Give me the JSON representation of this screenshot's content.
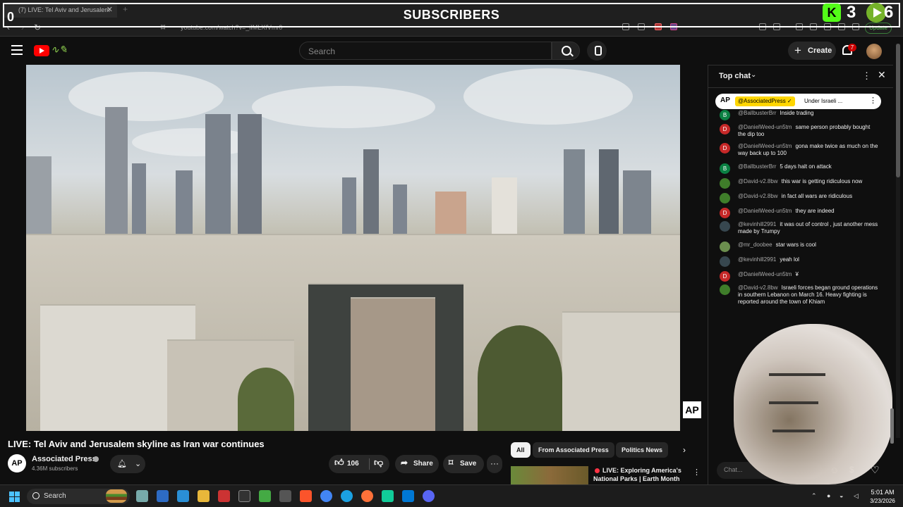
{
  "browser": {
    "tab_title": "(7) LIVE: Tel Aviv and Jerusalem",
    "tab_close": "✕",
    "tab_new": "+",
    "url": "youtube.com/watch?v=_iIMLXfVmr0",
    "update_label": "Update"
  },
  "stream_overlay": {
    "subscriber_counter": "0",
    "subscribers_title": "SUBSCRIBERS",
    "kick_letter": "K",
    "kick_count": "3",
    "rumble_count": "6"
  },
  "youtube_header": {
    "search_placeholder": "Search",
    "create_label": "Create",
    "notification_count": "7"
  },
  "video": {
    "title": "LIVE: Tel Aviv and Jerusalem skyline as Iran war continues",
    "watermark": "AP"
  },
  "channel": {
    "avatar_text": "AP",
    "name": "Associated Press",
    "subscribers": "4.36M subscribers"
  },
  "actions": {
    "like_count": "106",
    "share_label": "Share",
    "save_label": "Save",
    "more_label": "···"
  },
  "chips": [
    "All",
    "From Associated Press",
    "Politics News"
  ],
  "recommendation": {
    "title": "LIVE: Exploring America's National Parks | Earth Month ..."
  },
  "chat": {
    "header_title": "Top chat",
    "pinned": {
      "avatar_text": "AP",
      "author": "@AssociatedPress ✓",
      "text": "Under Israeli ..."
    },
    "messages": [
      {
        "initial": "B",
        "color": "#0b8043",
        "author": "@BallbusterBrr",
        "text": "Inside trading"
      },
      {
        "initial": "D",
        "color": "#c62828",
        "author": "@DanielWeed-un5tm",
        "text": "same person probably bought the dip too"
      },
      {
        "initial": "D",
        "color": "#c62828",
        "author": "@DanielWeed-un5tm",
        "text": "gona make twice as much on the way back up to 100"
      },
      {
        "initial": "B",
        "color": "#0b8043",
        "author": "@BallbusterBrr",
        "text": "5 days halt on attack"
      },
      {
        "initial": "",
        "color": "#3f7d2a",
        "author": "@David-v2.8bw",
        "text": "this war is getting ridiculous now"
      },
      {
        "initial": "",
        "color": "#3f7d2a",
        "author": "@David-v2.8bw",
        "text": "in fact all wars are ridiculous"
      },
      {
        "initial": "D",
        "color": "#c62828",
        "author": "@DanielWeed-un5tm",
        "text": "they are indeed"
      },
      {
        "initial": "",
        "color": "#37474f",
        "author": "@kevinhill2991",
        "text": "it was out of control , just another mess made by Trumpy"
      },
      {
        "initial": "",
        "color": "#6b8e4e",
        "author": "@mr_doobee",
        "text": "star wars is cool"
      },
      {
        "initial": "",
        "color": "#37474f",
        "author": "@kevinhill2991",
        "text": "yeah lol"
      },
      {
        "initial": "D",
        "color": "#c62828",
        "author": "@DanielWeed-un5tm",
        "text": "¥"
      },
      {
        "initial": "",
        "color": "#3f7d2a",
        "author": "@David-v2.8bw",
        "text": "Israeli forces began ground operations in southern Lebanon on March 16. Heavy fighting is reported around the town of Khiam"
      }
    ],
    "input_placeholder": "Chat..."
  },
  "taskbar": {
    "search_label": "Search",
    "time": "5:01 AM",
    "date": "3/23/2026"
  }
}
